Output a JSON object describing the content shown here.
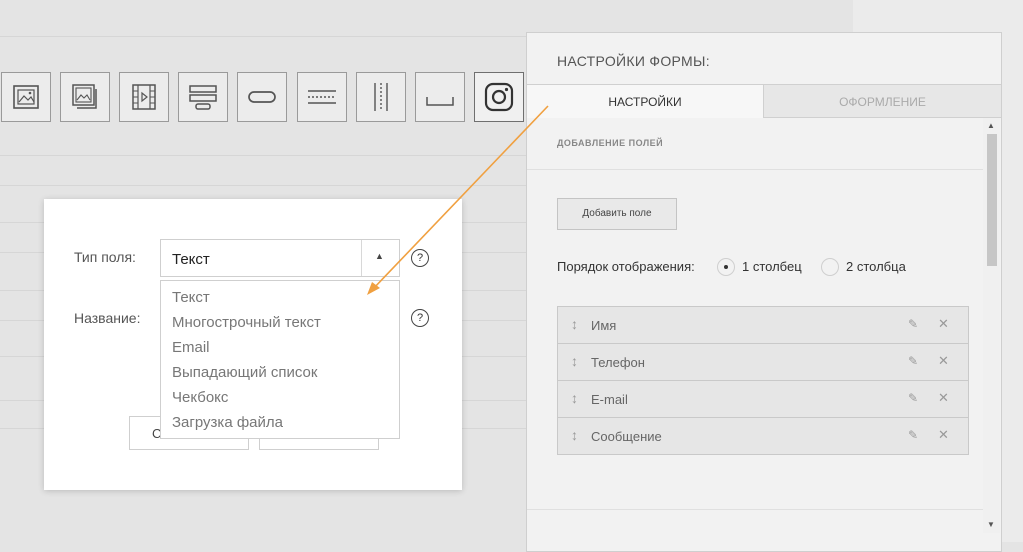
{
  "toolbar": {
    "tools": [
      {
        "icon": "image-icon"
      },
      {
        "icon": "gallery-icon"
      },
      {
        "icon": "video-icon"
      },
      {
        "icon": "text-block-icon"
      },
      {
        "icon": "button-icon"
      },
      {
        "icon": "lines-icon"
      },
      {
        "icon": "columns-icon"
      },
      {
        "icon": "spacer-icon"
      },
      {
        "icon": "instagram-icon"
      }
    ]
  },
  "modal": {
    "field_type_label": "Тип поля:",
    "field_type_value": "Текст",
    "name_label": "Название:",
    "help_glyph": "?",
    "button_partial": "С",
    "options": [
      "Текст",
      "Многострочный текст",
      "Email",
      "Выпадающий список",
      "Чекбокс",
      "Загрузка файла"
    ]
  },
  "panel": {
    "title": "НАСТРОЙКИ ФОРМЫ:",
    "tabs": [
      "НАСТРОЙКИ",
      "ОФОРМЛЕНИЕ"
    ],
    "section_label": "ДОБАВЛЕНИЕ ПОЛЕЙ",
    "add_button": "Добавить поле",
    "order_label": "Порядок отображения:",
    "order_options": [
      "1 столбец",
      "2 столбца"
    ],
    "order_selected": 0,
    "fields": [
      "Имя",
      "Телефон",
      "E-mail",
      "Сообщение"
    ]
  },
  "colors": {
    "arrow": "#f0a040",
    "panel_bg": "#f2f2f2"
  }
}
